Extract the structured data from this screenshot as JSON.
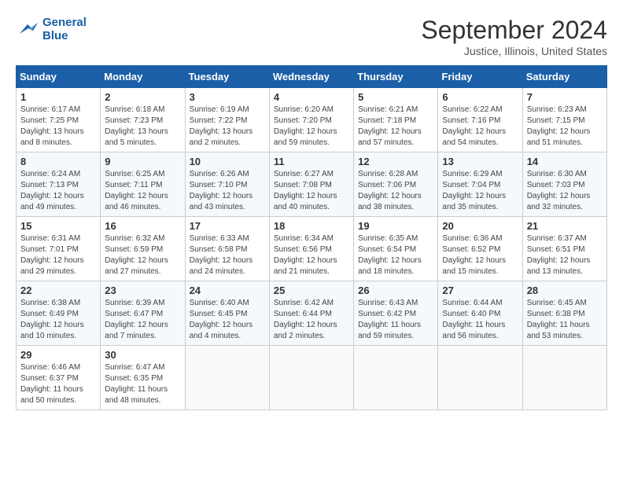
{
  "header": {
    "logo_line1": "General",
    "logo_line2": "Blue",
    "month_title": "September 2024",
    "location": "Justice, Illinois, United States"
  },
  "days_of_week": [
    "Sunday",
    "Monday",
    "Tuesday",
    "Wednesday",
    "Thursday",
    "Friday",
    "Saturday"
  ],
  "weeks": [
    [
      {
        "day": "1",
        "sunrise": "Sunrise: 6:17 AM",
        "sunset": "Sunset: 7:25 PM",
        "daylight": "Daylight: 13 hours and 8 minutes."
      },
      {
        "day": "2",
        "sunrise": "Sunrise: 6:18 AM",
        "sunset": "Sunset: 7:23 PM",
        "daylight": "Daylight: 13 hours and 5 minutes."
      },
      {
        "day": "3",
        "sunrise": "Sunrise: 6:19 AM",
        "sunset": "Sunset: 7:22 PM",
        "daylight": "Daylight: 13 hours and 2 minutes."
      },
      {
        "day": "4",
        "sunrise": "Sunrise: 6:20 AM",
        "sunset": "Sunset: 7:20 PM",
        "daylight": "Daylight: 12 hours and 59 minutes."
      },
      {
        "day": "5",
        "sunrise": "Sunrise: 6:21 AM",
        "sunset": "Sunset: 7:18 PM",
        "daylight": "Daylight: 12 hours and 57 minutes."
      },
      {
        "day": "6",
        "sunrise": "Sunrise: 6:22 AM",
        "sunset": "Sunset: 7:16 PM",
        "daylight": "Daylight: 12 hours and 54 minutes."
      },
      {
        "day": "7",
        "sunrise": "Sunrise: 6:23 AM",
        "sunset": "Sunset: 7:15 PM",
        "daylight": "Daylight: 12 hours and 51 minutes."
      }
    ],
    [
      {
        "day": "8",
        "sunrise": "Sunrise: 6:24 AM",
        "sunset": "Sunset: 7:13 PM",
        "daylight": "Daylight: 12 hours and 49 minutes."
      },
      {
        "day": "9",
        "sunrise": "Sunrise: 6:25 AM",
        "sunset": "Sunset: 7:11 PM",
        "daylight": "Daylight: 12 hours and 46 minutes."
      },
      {
        "day": "10",
        "sunrise": "Sunrise: 6:26 AM",
        "sunset": "Sunset: 7:10 PM",
        "daylight": "Daylight: 12 hours and 43 minutes."
      },
      {
        "day": "11",
        "sunrise": "Sunrise: 6:27 AM",
        "sunset": "Sunset: 7:08 PM",
        "daylight": "Daylight: 12 hours and 40 minutes."
      },
      {
        "day": "12",
        "sunrise": "Sunrise: 6:28 AM",
        "sunset": "Sunset: 7:06 PM",
        "daylight": "Daylight: 12 hours and 38 minutes."
      },
      {
        "day": "13",
        "sunrise": "Sunrise: 6:29 AM",
        "sunset": "Sunset: 7:04 PM",
        "daylight": "Daylight: 12 hours and 35 minutes."
      },
      {
        "day": "14",
        "sunrise": "Sunrise: 6:30 AM",
        "sunset": "Sunset: 7:03 PM",
        "daylight": "Daylight: 12 hours and 32 minutes."
      }
    ],
    [
      {
        "day": "15",
        "sunrise": "Sunrise: 6:31 AM",
        "sunset": "Sunset: 7:01 PM",
        "daylight": "Daylight: 12 hours and 29 minutes."
      },
      {
        "day": "16",
        "sunrise": "Sunrise: 6:32 AM",
        "sunset": "Sunset: 6:59 PM",
        "daylight": "Daylight: 12 hours and 27 minutes."
      },
      {
        "day": "17",
        "sunrise": "Sunrise: 6:33 AM",
        "sunset": "Sunset: 6:58 PM",
        "daylight": "Daylight: 12 hours and 24 minutes."
      },
      {
        "day": "18",
        "sunrise": "Sunrise: 6:34 AM",
        "sunset": "Sunset: 6:56 PM",
        "daylight": "Daylight: 12 hours and 21 minutes."
      },
      {
        "day": "19",
        "sunrise": "Sunrise: 6:35 AM",
        "sunset": "Sunset: 6:54 PM",
        "daylight": "Daylight: 12 hours and 18 minutes."
      },
      {
        "day": "20",
        "sunrise": "Sunrise: 6:36 AM",
        "sunset": "Sunset: 6:52 PM",
        "daylight": "Daylight: 12 hours and 15 minutes."
      },
      {
        "day": "21",
        "sunrise": "Sunrise: 6:37 AM",
        "sunset": "Sunset: 6:51 PM",
        "daylight": "Daylight: 12 hours and 13 minutes."
      }
    ],
    [
      {
        "day": "22",
        "sunrise": "Sunrise: 6:38 AM",
        "sunset": "Sunset: 6:49 PM",
        "daylight": "Daylight: 12 hours and 10 minutes."
      },
      {
        "day": "23",
        "sunrise": "Sunrise: 6:39 AM",
        "sunset": "Sunset: 6:47 PM",
        "daylight": "Daylight: 12 hours and 7 minutes."
      },
      {
        "day": "24",
        "sunrise": "Sunrise: 6:40 AM",
        "sunset": "Sunset: 6:45 PM",
        "daylight": "Daylight: 12 hours and 4 minutes."
      },
      {
        "day": "25",
        "sunrise": "Sunrise: 6:42 AM",
        "sunset": "Sunset: 6:44 PM",
        "daylight": "Daylight: 12 hours and 2 minutes."
      },
      {
        "day": "26",
        "sunrise": "Sunrise: 6:43 AM",
        "sunset": "Sunset: 6:42 PM",
        "daylight": "Daylight: 11 hours and 59 minutes."
      },
      {
        "day": "27",
        "sunrise": "Sunrise: 6:44 AM",
        "sunset": "Sunset: 6:40 PM",
        "daylight": "Daylight: 11 hours and 56 minutes."
      },
      {
        "day": "28",
        "sunrise": "Sunrise: 6:45 AM",
        "sunset": "Sunset: 6:38 PM",
        "daylight": "Daylight: 11 hours and 53 minutes."
      }
    ],
    [
      {
        "day": "29",
        "sunrise": "Sunrise: 6:46 AM",
        "sunset": "Sunset: 6:37 PM",
        "daylight": "Daylight: 11 hours and 50 minutes."
      },
      {
        "day": "30",
        "sunrise": "Sunrise: 6:47 AM",
        "sunset": "Sunset: 6:35 PM",
        "daylight": "Daylight: 11 hours and 48 minutes."
      },
      null,
      null,
      null,
      null,
      null
    ]
  ]
}
